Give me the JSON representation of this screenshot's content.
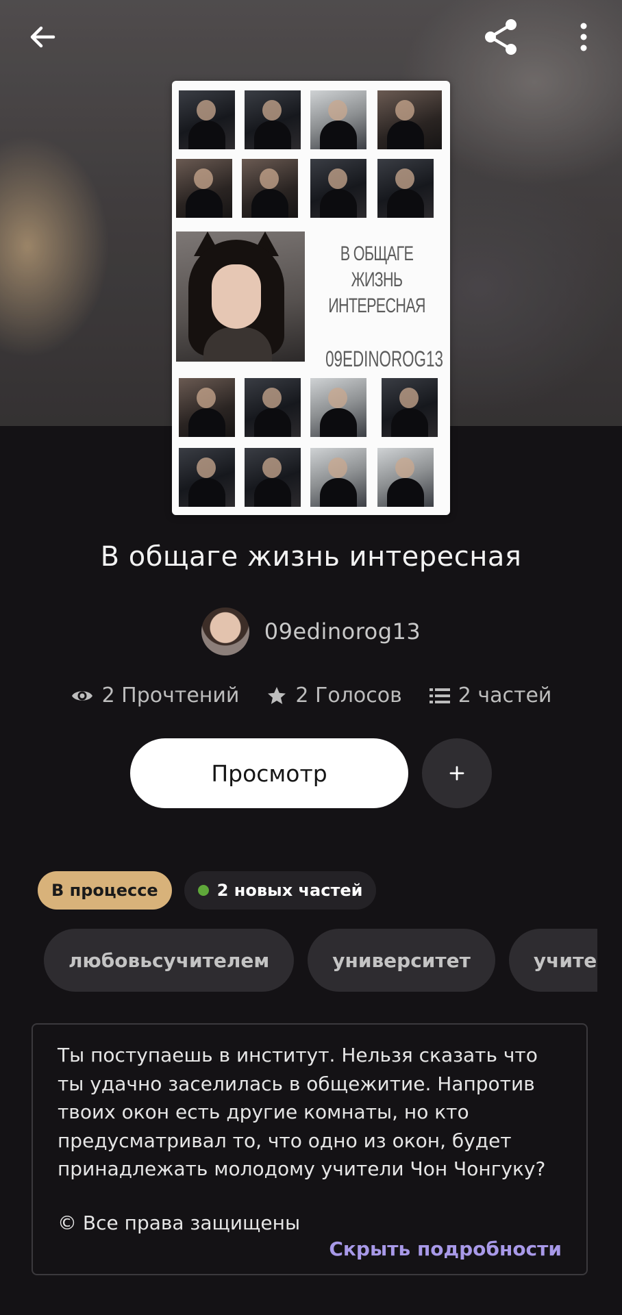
{
  "header": {
    "back_icon": "arrow-left-icon",
    "share_icon": "share-icon",
    "menu_icon": "more-vertical-icon"
  },
  "cover": {
    "title_line1": "В ОБЩАГЕ ЖИЗНЬ",
    "title_line2": "ИНТЕРЕСНАЯ",
    "author": "09EDINOROG13"
  },
  "book": {
    "title": "В общаге жизнь интересная",
    "author": "09edinorog13"
  },
  "stats": {
    "reads": "2 Прочтений",
    "votes": "2 Голосов",
    "parts": "2 частей"
  },
  "actions": {
    "view_label": "Просмотр",
    "add_label": "+"
  },
  "badges": {
    "status": "В процессе",
    "new_parts": "2 новых частей"
  },
  "tags": [
    "любовьсучителем",
    "университет",
    "учитель"
  ],
  "description": {
    "text": "Ты поступаешь в институт. Нельзя сказать что ты удачно заселилась в общежитие. Напротив твоих окон есть другие комнаты, но кто предусматривал то, что одно из окон, будет принадлежать молодому учители Чон Чонгуку?",
    "rights": "© Все права защищены",
    "hide_link": "Скрыть подробности"
  },
  "colors": {
    "background": "#141215",
    "status_badge": "#d8b27a",
    "new_dot": "#5fa83a",
    "link": "#a899e8"
  }
}
